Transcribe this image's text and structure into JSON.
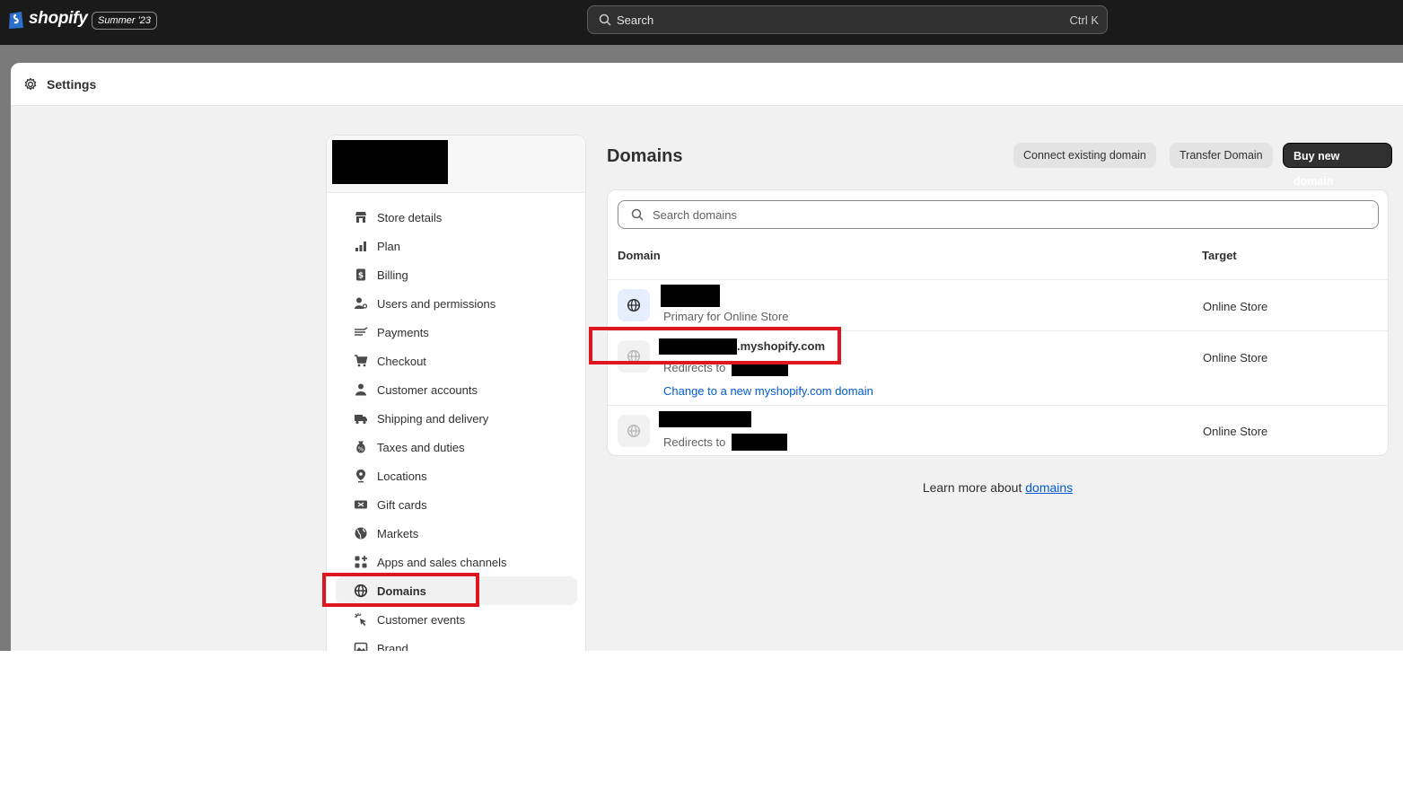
{
  "topbar": {
    "brand": "shopify",
    "edition": "Summer '23",
    "search_label": "Search",
    "search_shortcut": "Ctrl K"
  },
  "modal": {
    "title": "Settings"
  },
  "sidebar": {
    "items": [
      {
        "label": "Store details",
        "icon": "store-icon"
      },
      {
        "label": "Plan",
        "icon": "plan-icon"
      },
      {
        "label": "Billing",
        "icon": "billing-icon"
      },
      {
        "label": "Users and permissions",
        "icon": "users-icon"
      },
      {
        "label": "Payments",
        "icon": "payments-icon"
      },
      {
        "label": "Checkout",
        "icon": "cart-icon"
      },
      {
        "label": "Customer accounts",
        "icon": "person-icon"
      },
      {
        "label": "Shipping and delivery",
        "icon": "truck-icon"
      },
      {
        "label": "Taxes and duties",
        "icon": "tax-icon"
      },
      {
        "label": "Locations",
        "icon": "location-icon"
      },
      {
        "label": "Gift cards",
        "icon": "gift-card-icon"
      },
      {
        "label": "Markets",
        "icon": "globe-icon"
      },
      {
        "label": "Apps and sales channels",
        "icon": "apps-icon"
      },
      {
        "label": "Domains",
        "icon": "domain-globe-icon",
        "active": true
      },
      {
        "label": "Customer events",
        "icon": "cursor-click-icon"
      },
      {
        "label": "Brand",
        "icon": "brand-icon"
      }
    ]
  },
  "main": {
    "title": "Domains",
    "buttons": {
      "connect": "Connect existing domain",
      "transfer": "Transfer Domain",
      "buy": "Buy new domain"
    },
    "search_placeholder": "Search domains",
    "columns": {
      "domain": "Domain",
      "target": "Target"
    },
    "rows": [
      {
        "name": "",
        "sub": "Primary for Online Store",
        "target": "Online Store"
      },
      {
        "name": ".myshopify.com",
        "sub": "Redirects to",
        "link": "Change to a new myshopify.com domain",
        "target": "Online Store"
      },
      {
        "name": "",
        "sub": "Redirects to",
        "target": "Online Store"
      }
    ],
    "learn_more_text": "Learn more about",
    "learn_more_link": "domains"
  },
  "colors": {
    "topbar": "#1a1a1a",
    "primary_button": "#303030",
    "link": "#005bd3",
    "highlight": "#e0161f"
  }
}
